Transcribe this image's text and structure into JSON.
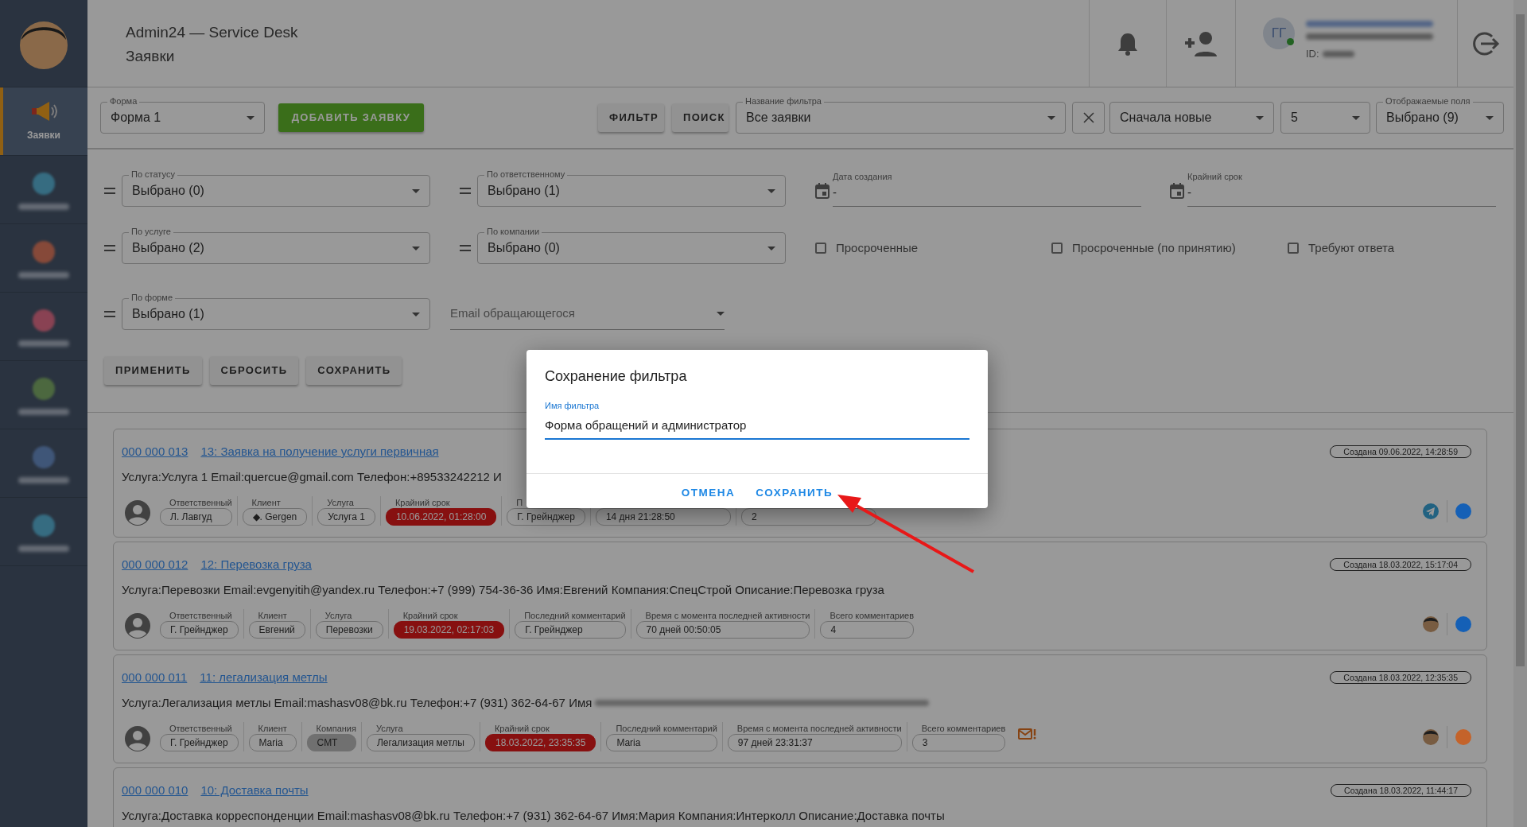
{
  "sidebar": {
    "items": [
      {
        "label": "Заявки",
        "selected": true
      },
      {
        "selected": false
      },
      {
        "selected": false
      },
      {
        "selected": false
      },
      {
        "selected": false
      },
      {
        "selected": false
      },
      {
        "selected": false
      }
    ]
  },
  "header": {
    "title": "Admin24 — Service Desk",
    "subtitle": "Заявки",
    "user": {
      "initials": "ГГ",
      "online": true,
      "id_label": "ID:"
    }
  },
  "toolbar": {
    "form_select": {
      "label": "Форма",
      "value": "Форма 1"
    },
    "add_button": "ДОБАВИТЬ ЗАЯВКУ",
    "filter_button": "ФИЛЬТР",
    "search_button": "ПОИСК",
    "filter_name": {
      "label": "Название фильтра",
      "value": "Все заявки"
    },
    "sort": {
      "value": "Сначала новые"
    },
    "per_page": {
      "value": "5"
    },
    "fields": {
      "label": "Отображаемые поля",
      "value": "Выбрано (9)"
    }
  },
  "filters": {
    "rows": [
      [
        {
          "kind": "select",
          "label": "По статусу",
          "value": "Выбрано (0)"
        },
        {
          "kind": "select",
          "label": "По ответственному",
          "value": "Выбрано (1)"
        },
        {
          "kind": "date",
          "label": "Дата создания",
          "value": "-"
        },
        {
          "kind": "date",
          "label": "Крайний срок",
          "value": "-"
        }
      ],
      [
        {
          "kind": "select",
          "label": "По услуге",
          "value": "Выбрано (2)"
        },
        {
          "kind": "select",
          "label": "По компании",
          "value": "Выбрано (0)"
        },
        {
          "kind": "checkbox",
          "label": "Просроченные",
          "checked": false
        },
        {
          "kind": "checkbox",
          "label": "Просроченные (по принятию)",
          "checked": false
        },
        {
          "kind": "checkbox",
          "label": "Требуют ответа",
          "checked": false
        }
      ],
      [
        {
          "kind": "select",
          "label": "По форме",
          "value": "Выбрано (1)"
        },
        {
          "kind": "email",
          "placeholder": "Email обращающегося"
        }
      ]
    ],
    "buttons": [
      "ПРИМЕНИТЬ",
      "СБРОСИТЬ",
      "СОХРАНИТЬ"
    ]
  },
  "tickets": [
    {
      "number": "000 000 013",
      "title": "13: Заявка на получение услуги первичная",
      "created": "Создана 09.06.2022, 14:28:59",
      "description": "Услуга:Услуга 1 Email:quercue@gmail.com Телефон:+89533242212 И",
      "redacted_tail": false,
      "kind": "telegram",
      "color": "#1560b6",
      "fields": [
        {
          "label": "Ответственный",
          "value": "Л. Лавгуд",
          "kind": "outline"
        },
        {
          "label": "Клиент",
          "value": "◆. Gergen",
          "kind": "outline"
        },
        {
          "label": "Услуга",
          "value": "Услуга 1",
          "kind": "outline"
        },
        {
          "label": "Крайний срок",
          "value": "10.06.2022, 01:28:00",
          "kind": "deadline"
        },
        {
          "label": "П",
          "value": "Г. Грейнджер",
          "kind": "outline"
        },
        {
          "value": "14 дня 21:28:50",
          "kind": "outline"
        },
        {
          "value": "2",
          "kind": "outline"
        }
      ]
    },
    {
      "number": "000 000 012",
      "title": "12: Перевозка груза",
      "created": "Создана 18.03.2022, 15:17:04",
      "description": "Услуга:Перевозки Email:evgenyitih@yandex.ru Телефон:+7 (999) 754-36-36 Имя:Евгений Компания:СпецСтрой Описание:Перевозка груза",
      "redacted_tail": false,
      "kind": "avatar",
      "color": "#1560b6",
      "fields": [
        {
          "label": "Ответственный",
          "value": "Г. Грейнджер",
          "kind": "outline"
        },
        {
          "label": "Клиент",
          "value": "Евгений",
          "kind": "outline"
        },
        {
          "label": "Услуга",
          "value": "Перевозки",
          "kind": "outline"
        },
        {
          "label": "Крайний срок",
          "value": "19.03.2022, 02:17:03",
          "kind": "deadline"
        },
        {
          "label": "Последний комментарий",
          "value": "Г. Грейнджер",
          "kind": "outline"
        },
        {
          "label": "Время с момента последней активности",
          "value": "70 дней 00:50:05",
          "kind": "outline"
        },
        {
          "label": "Всего комментариев",
          "value": "4",
          "kind": "outline"
        }
      ]
    },
    {
      "number": "000 000 011",
      "title": "11: легализация метлы",
      "created": "Создана 18.03.2022, 12:35:35",
      "description": "Услуга:Легализация метлы Email:mashasv08@bk.ru Телефон:+7 (931) 362-64-67 Имя",
      "redacted_tail": true,
      "kind": "avatar",
      "color": "#c4632a",
      "unread_mail": true,
      "fields": [
        {
          "label": "Ответственный",
          "value": "Г. Грейнджер",
          "kind": "outline"
        },
        {
          "label": "Клиент",
          "value": "Maria",
          "kind": "outline"
        },
        {
          "label": "Компания",
          "value": "СМТ",
          "kind": "filled"
        },
        {
          "label": "Услуга",
          "value": "Легализация метлы",
          "kind": "outline"
        },
        {
          "label": "Крайний срок",
          "value": "18.03.2022, 23:35:35",
          "kind": "deadline"
        },
        {
          "label": "Последний комментарий",
          "value": "Maria",
          "kind": "outline"
        },
        {
          "label": "Время с момента последней активности",
          "value": "97 дней 23:31:37",
          "kind": "outline"
        },
        {
          "label": "Всего комментариев",
          "value": "3",
          "kind": "outline"
        }
      ]
    },
    {
      "number": "000 000 010",
      "title": "10: Доставка почты",
      "created": "Создана 18.03.2022, 11:44:17",
      "description": "Услуга:Доставка корреспонденции Email:mashasv08@bk.ru Телефон:+7 (931) 362-64-67 Имя:Мария Компания:Интерколл Описание:Доставка почты",
      "redacted_tail": false
    }
  ],
  "dialog": {
    "title": "Сохранение фильтра",
    "field_label": "Имя фильтра",
    "value": "Форма обращений и администратор",
    "buttons": [
      "ОТМЕНА",
      "СОХРАНИТЬ"
    ],
    "arrow": true
  }
}
